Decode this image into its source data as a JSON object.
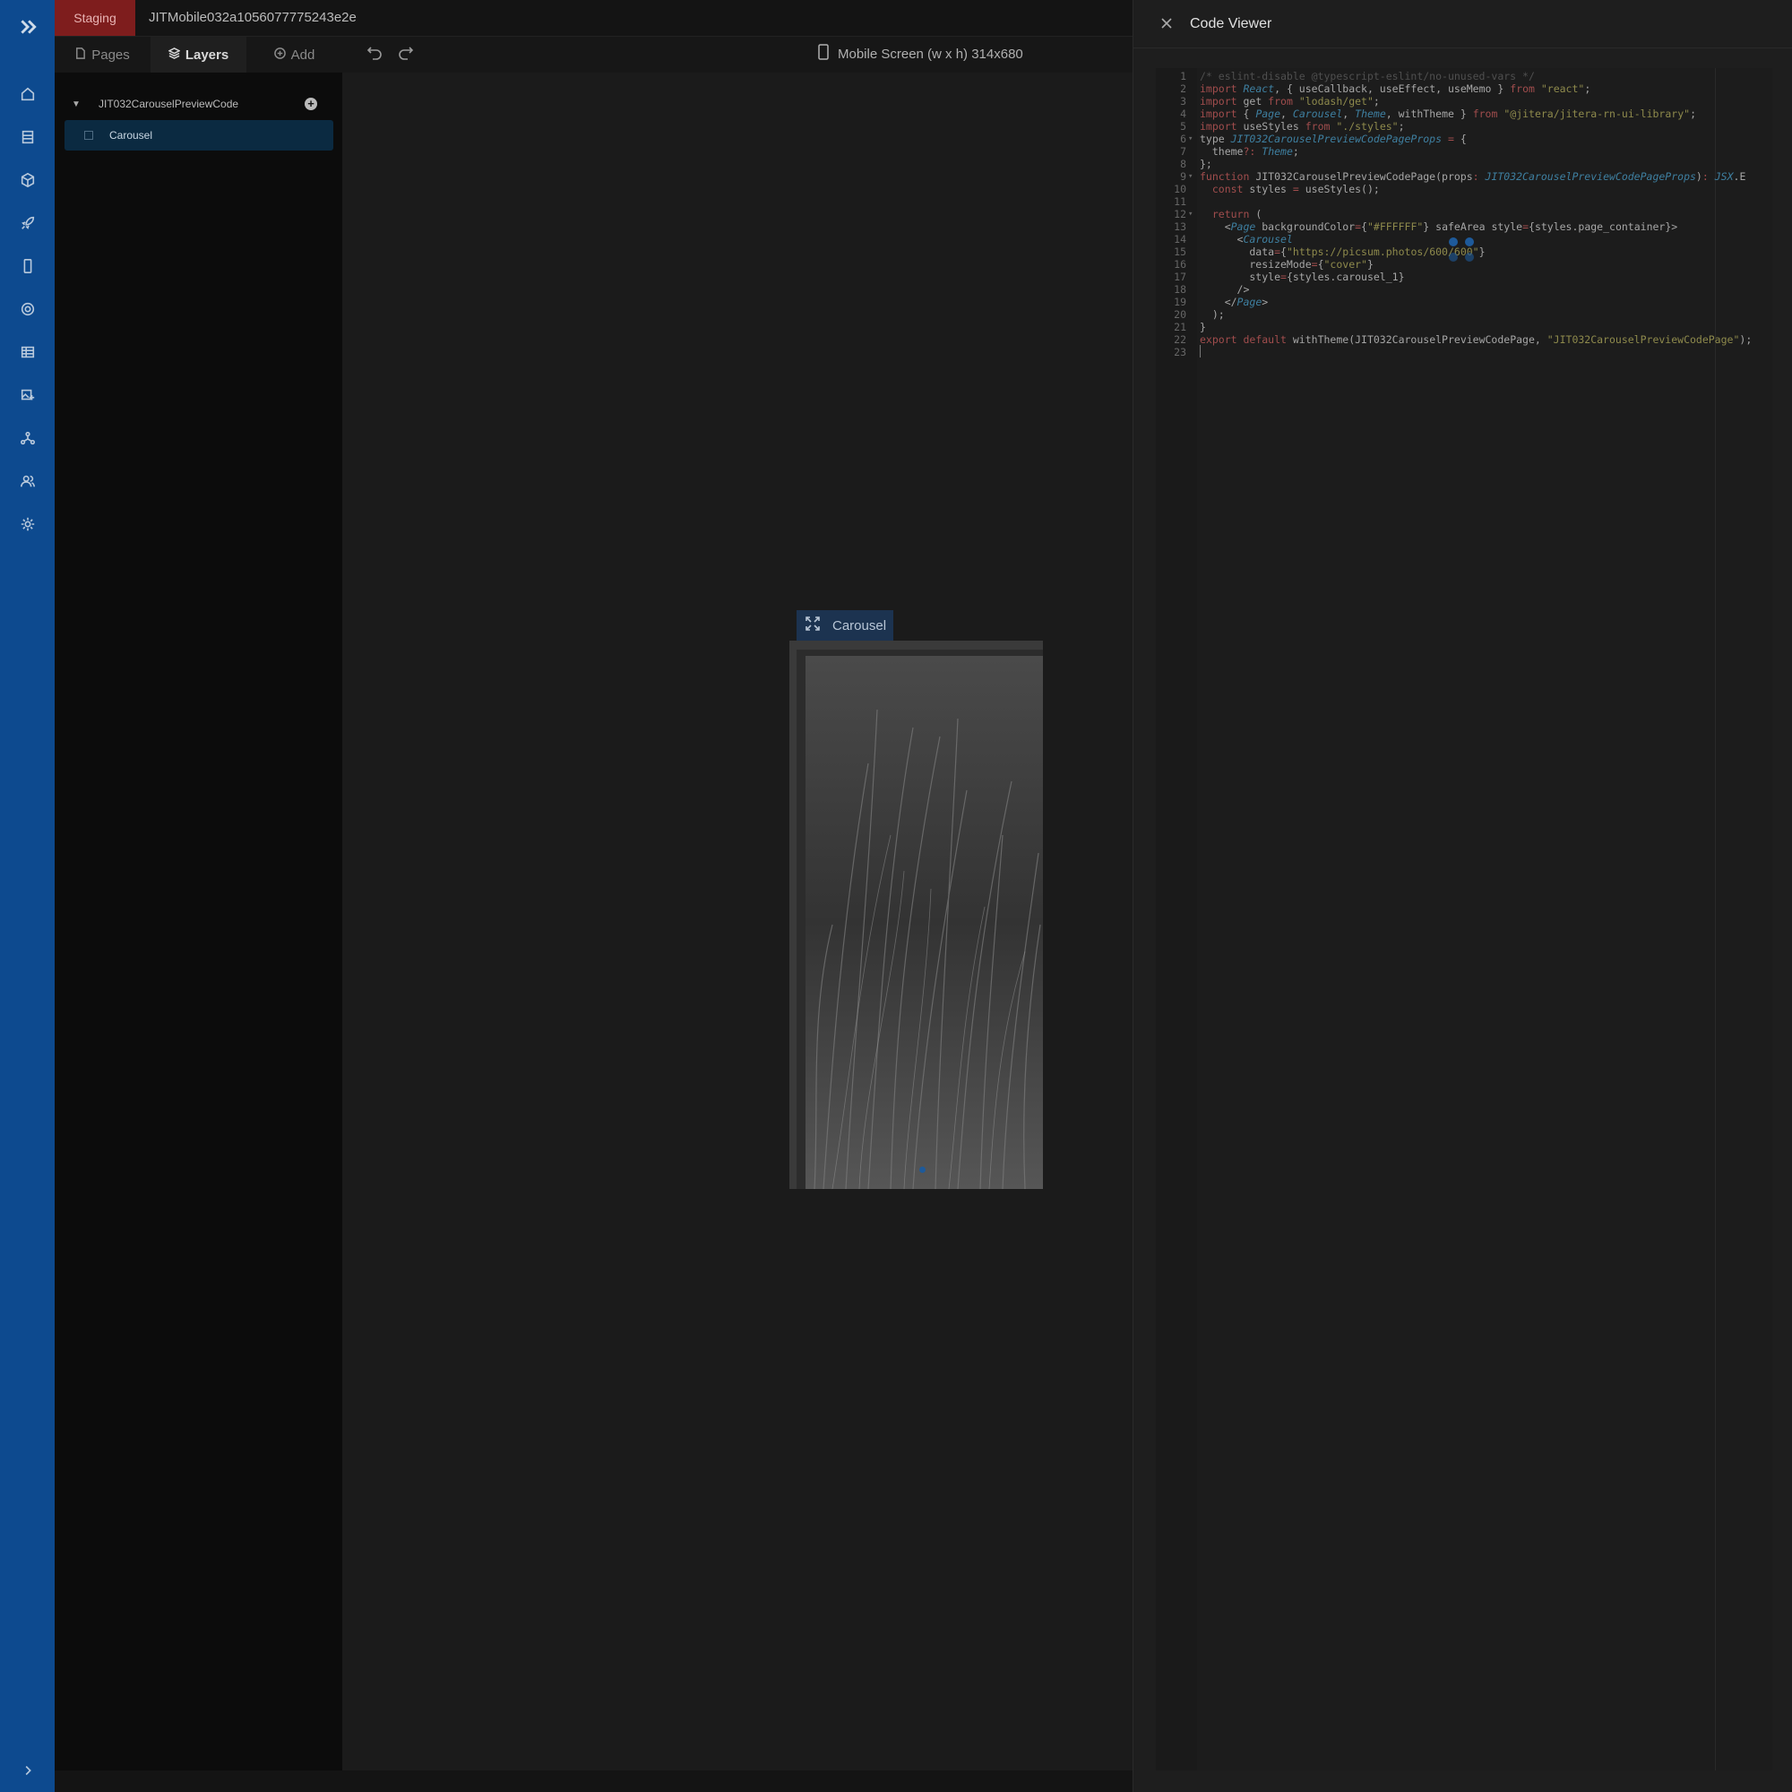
{
  "app": {
    "environment": "Staging",
    "project_name": "JITMobile032a1056077775243e2e"
  },
  "tabs": [
    {
      "label": "Pages",
      "icon": "page-icon"
    },
    {
      "label": "Layers",
      "icon": "layers-icon"
    },
    {
      "label": "Add",
      "icon": "add-circle-icon"
    }
  ],
  "toolbar": {
    "device_label": "Mobile Screen (w x h) 314x680"
  },
  "layers": {
    "root": "JIT032CarouselPreviewCode",
    "selected_item": "Carousel"
  },
  "canvas": {
    "frame_label": "Carousel"
  },
  "code_viewer": {
    "title": "Code Viewer",
    "lines": [
      "/* eslint-disable @typescript-eslint/no-unused-vars */",
      "import React, { useCallback, useEffect, useMemo } from \"react\";",
      "import get from \"lodash/get\";",
      "import { Page, Carousel, Theme, withTheme } from \"@jitera/jitera-rn-ui-library\";",
      "import useStyles from \"./styles\";",
      "type JIT032CarouselPreviewCodePageProps = {",
      "  theme?: Theme;",
      "};",
      "function JIT032CarouselPreviewCodePage(props: JIT032CarouselPreviewCodePageProps): JSX.E",
      "  const styles = useStyles();",
      "",
      "  return (",
      "    <Page backgroundColor={\"#FFFFFF\"} safeArea style={styles.page_container}>",
      "      <Carousel",
      "        data={\"https://picsum.photos/600/600\"}",
      "        resizeMode={\"cover\"}",
      "        style={styles.carousel_1}",
      "      />",
      "    </Page>",
      "  );",
      "}",
      "export default withTheme(JIT032CarouselPreviewCodePage, \"JIT032CarouselPreviewCodePage\");",
      ""
    ]
  },
  "colors": {
    "rail": "#0d4a8f",
    "staging_badge": "#7e1d1d",
    "selection": "#0b2a41"
  }
}
